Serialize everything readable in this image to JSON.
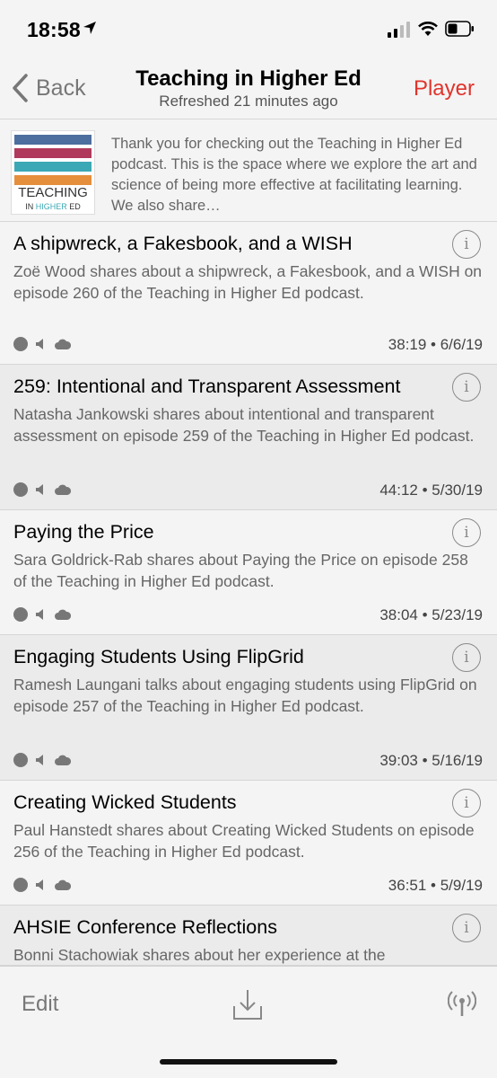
{
  "status_bar": {
    "time": "18:58"
  },
  "nav": {
    "back_label": "Back",
    "title": "Teaching in Higher Ed",
    "subtitle": "Refreshed 21 minutes ago",
    "player_label": "Player"
  },
  "podcast": {
    "artwork_word": "TEACHING",
    "artwork_sub_prefix": "IN ",
    "artwork_sub_highlight": "HIGHER",
    "artwork_sub_suffix": " ED",
    "stripe_colors": [
      "#4d6f9f",
      "#b03a5b",
      "#3ba9b5",
      "#e58f3c"
    ],
    "description": "Thank you for checking out the Teaching in Higher Ed podcast. This is the space where we explore the art and science of being more effective at facilitating learning. We also share…"
  },
  "episodes": [
    {
      "title": "A shipwreck, a Fakesbook, and a WISH",
      "description": "Zoë Wood shares about a shipwreck, a Fakesbook, and a WISH on episode 260 of the Teaching in Higher Ed podcast.",
      "meta": "38:19 • 6/6/19"
    },
    {
      "title": "259: Intentional and Transparent Assessment",
      "description": "Natasha Jankowski shares about intentional and transparent assessment on episode 259 of the Teaching in Higher Ed podcast.",
      "meta": "44:12 • 5/30/19"
    },
    {
      "title": "Paying the Price",
      "description": "Sara Goldrick-Rab shares about Paying the Price on episode 258 of the Teaching in Higher Ed podcast.",
      "meta": "38:04 • 5/23/19"
    },
    {
      "title": "Engaging Students Using FlipGrid",
      "description": "Ramesh Laungani talks about engaging students using FlipGrid on episode 257 of the Teaching in Higher Ed podcast.",
      "meta": "39:03 • 5/16/19"
    },
    {
      "title": "Creating Wicked Students",
      "description": "Paul Hanstedt shares about Creating Wicked Students on episode 256 of the Teaching in Higher Ed podcast.",
      "meta": "36:51 • 5/9/19"
    },
    {
      "title": "AHSIE Conference Reflections",
      "description": "Bonni Stachowiak shares about her experience at the",
      "meta": ""
    }
  ],
  "toolbar": {
    "edit_label": "Edit"
  }
}
